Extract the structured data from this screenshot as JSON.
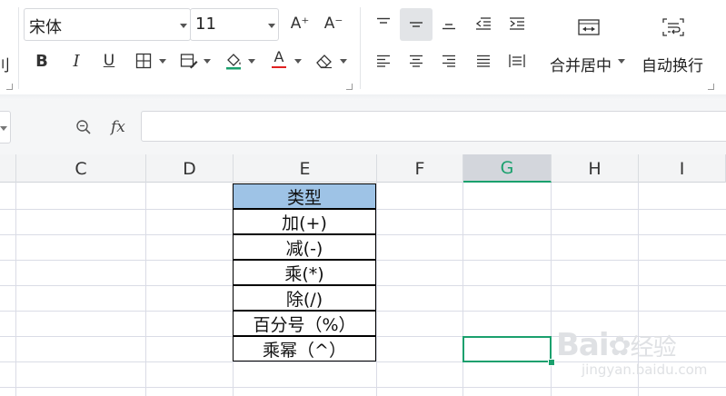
{
  "ribbon": {
    "font_name": "宋体",
    "font_size": "11",
    "clipped_left_glyph": "刂",
    "increase_font_label": "A⁺",
    "decrease_font_label": "A⁻",
    "bold_label": "B",
    "italic_label": "I",
    "underline_label": "U",
    "font_color_letter": "A",
    "merge_center_label": "合并居中",
    "wrap_text_label": "自动换行"
  },
  "formula_bar": {
    "fx_label": "fx",
    "value": ""
  },
  "columns": [
    {
      "label": "C"
    },
    {
      "label": "D"
    },
    {
      "label": "E"
    },
    {
      "label": "F"
    },
    {
      "label": "G",
      "selected": true
    },
    {
      "label": "H"
    },
    {
      "label": "I"
    }
  ],
  "table": {
    "header": "类型",
    "rows": [
      "加(+)",
      "减(-)",
      "乘(*)",
      "除(/)",
      "百分号（%）",
      "乘幂（^）"
    ]
  },
  "selected_cell": "G",
  "watermark": {
    "brand": "Bai",
    "suffix": "经验",
    "url": "jingyan.baidu.com"
  },
  "colors": {
    "accent": "#1aa06d",
    "header_fill": "#9ec3e6",
    "font_color_underline": "#e02020"
  }
}
